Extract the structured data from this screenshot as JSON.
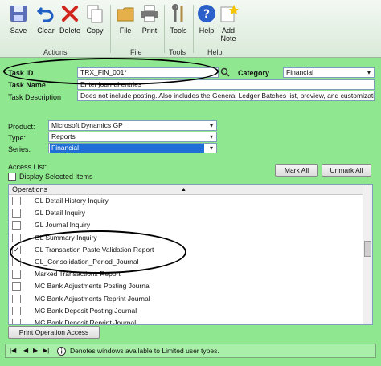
{
  "toolbar": {
    "save": "Save",
    "clear": "Clear",
    "delete": "Delete",
    "copy": "Copy",
    "file": "File",
    "print": "Print",
    "tools": "Tools",
    "help": "Help",
    "add_note_1": "Add",
    "add_note_2": "Note",
    "group_actions": "Actions",
    "group_file": "File",
    "group_tools": "Tools",
    "group_help": "Help"
  },
  "form": {
    "task_id_label": "Task ID",
    "task_id_value": "TRX_FIN_001*",
    "category_label": "Category",
    "category_value": "Financial",
    "task_name_label": "Task Name",
    "task_name_value": "Enter journal entries",
    "task_desc_label": "Task Description",
    "task_desc_value": "Does not include posting. Also includes the General Ledger Batches list, preview, and customization",
    "product_label": "Product:",
    "product_value": "Microsoft Dynamics GP",
    "type_label": "Type:",
    "type_value": "Reports",
    "series_label": "Series:",
    "series_value": "Financial"
  },
  "access": {
    "title": "Access List:",
    "display_selected": "Display Selected Items",
    "mark_all": "Mark All",
    "unmark_all": "Unmark All",
    "column_header": "Operations",
    "items": [
      {
        "label": "GL Detail History Inquiry",
        "checked": false
      },
      {
        "label": "GL Detail Inquiry",
        "checked": false
      },
      {
        "label": "GL Journal Inquiry",
        "checked": false
      },
      {
        "label": "GL Summary Inquiry",
        "checked": false
      },
      {
        "label": "GL Transaction Paste Validation Report",
        "checked": true
      },
      {
        "label": "GL_Consolidation_Period_Journal",
        "checked": false
      },
      {
        "label": "Marked Transactions Report",
        "checked": false
      },
      {
        "label": "MC Bank Adjustments Posting Journal",
        "checked": false
      },
      {
        "label": "MC Bank Adjustments Reprint Journal",
        "checked": false
      },
      {
        "label": "MC Bank Deposit Posting Journal",
        "checked": false
      },
      {
        "label": "MC Bank Deposit Reprint Journal",
        "checked": false
      }
    ],
    "print_button": "Print Operation Access"
  },
  "status": {
    "text": "Denotes windows available to Limited user types."
  },
  "colors": {
    "background": "#8fe88f",
    "series_highlight": "#1f6fd6"
  },
  "icons": [
    "save-icon",
    "clear-icon",
    "delete-icon",
    "copy-icon",
    "file-icon",
    "print-icon",
    "tools-icon",
    "help-icon",
    "add-note-icon",
    "lookup-icon",
    "info-icon"
  ]
}
